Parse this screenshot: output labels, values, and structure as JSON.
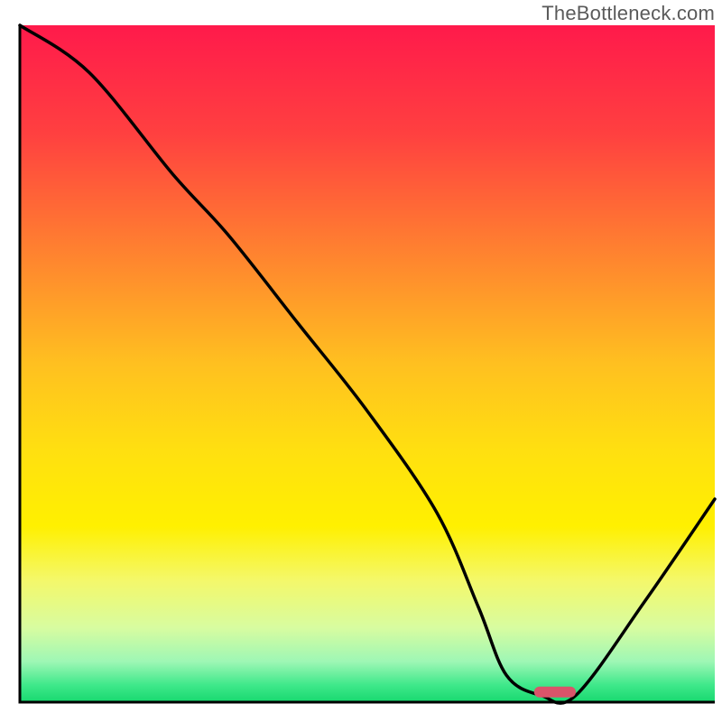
{
  "watermark": "TheBottleneck.com",
  "chart_data": {
    "type": "line",
    "title": "",
    "xlabel": "",
    "ylabel": "",
    "xlim": [
      0,
      100
    ],
    "ylim": [
      0,
      100
    ],
    "grid": false,
    "legend": false,
    "background_gradient": {
      "stops": [
        {
          "offset": 0.0,
          "color": "#ff1a4b"
        },
        {
          "offset": 0.16,
          "color": "#ff4040"
        },
        {
          "offset": 0.33,
          "color": "#ff8030"
        },
        {
          "offset": 0.5,
          "color": "#ffc020"
        },
        {
          "offset": 0.63,
          "color": "#ffe010"
        },
        {
          "offset": 0.74,
          "color": "#fff000"
        },
        {
          "offset": 0.82,
          "color": "#f4f86a"
        },
        {
          "offset": 0.89,
          "color": "#d8fca0"
        },
        {
          "offset": 0.94,
          "color": "#9ef7b5"
        },
        {
          "offset": 0.975,
          "color": "#3ee88a"
        },
        {
          "offset": 1.0,
          "color": "#18d86f"
        }
      ]
    },
    "series": [
      {
        "name": "bottleneck-curve",
        "color": "#000000",
        "x": [
          0,
          10,
          22,
          30,
          40,
          50,
          60,
          66,
          70,
          75,
          80,
          90,
          100
        ],
        "y": [
          100,
          93,
          78,
          69,
          56,
          43,
          28,
          14,
          4,
          1,
          1,
          15,
          30
        ]
      }
    ],
    "marker": {
      "name": "optimal-point",
      "x": 77,
      "y": 1.5,
      "width": 6,
      "height": 1.6,
      "color": "#d9546a"
    }
  }
}
